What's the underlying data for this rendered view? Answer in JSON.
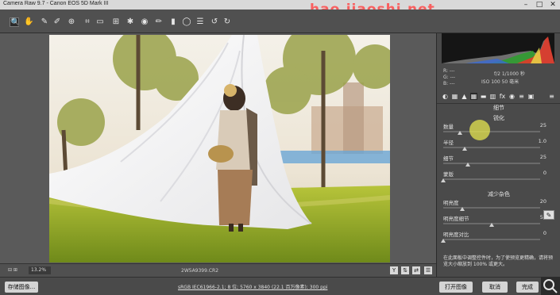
{
  "window": {
    "title": "Camera Raw 9.7 - Canon EOS 5D Mark III",
    "watermark": "hao.jiaoshi.net",
    "controls": {
      "minimize": "–",
      "maximize": "□",
      "close": "✕"
    }
  },
  "toolbar": {
    "tools": [
      "zoom-tool",
      "hand-tool",
      "white-balance-tool",
      "color-sampler-tool",
      "targeted-adjustment-tool",
      "crop-tool",
      "straighten-tool",
      "transform-tool",
      "spot-removal-tool",
      "red-eye-tool",
      "adjustment-brush",
      "graduated-filter",
      "radial-filter",
      "open-preferences",
      "rotate-ccw",
      "rotate-cw"
    ]
  },
  "status": {
    "zoom": "13.2%",
    "filename": "2W5A9399.CR2",
    "image_info": "sRGB IEC61966-2.1; 8 位; 5760 x 3840 (22.1 百万像素); 300 ppi"
  },
  "buttons": {
    "save": "存储图像...",
    "open": "打开图像",
    "cancel": "取消",
    "done": "完成"
  },
  "histogram": {
    "meta_left": [
      "R: ---",
      "G: ---",
      "B: ---"
    ],
    "meta_right_1": "f/2   1/1000 秒",
    "meta_right_2": "ISO 100   50 毫米"
  },
  "panel": {
    "tab_title": "细节",
    "sharpen_title": "锐化",
    "sharpen": [
      {
        "label": "数量",
        "value": "25",
        "pos": 0.17
      },
      {
        "label": "半径",
        "value": "1.0",
        "pos": 0.22
      },
      {
        "label": "细节",
        "value": "25",
        "pos": 0.25
      },
      {
        "label": "蒙版",
        "value": "0",
        "pos": 0.0
      }
    ],
    "noise_title": "减少杂色",
    "noise": [
      {
        "label": "明亮度",
        "value": "20",
        "pos": 0.2
      },
      {
        "label": "明亮度细节",
        "value": "50",
        "pos": 0.5
      },
      {
        "label": "明亮度对比",
        "value": "0",
        "pos": 0.0
      }
    ],
    "note": "在此面板中调整控件时，为了使预览更精确，请将预览大小缩放到 100% 或更大。"
  },
  "colors": {
    "accent": "#e8e26a",
    "watermark": "#ff4a4a"
  }
}
